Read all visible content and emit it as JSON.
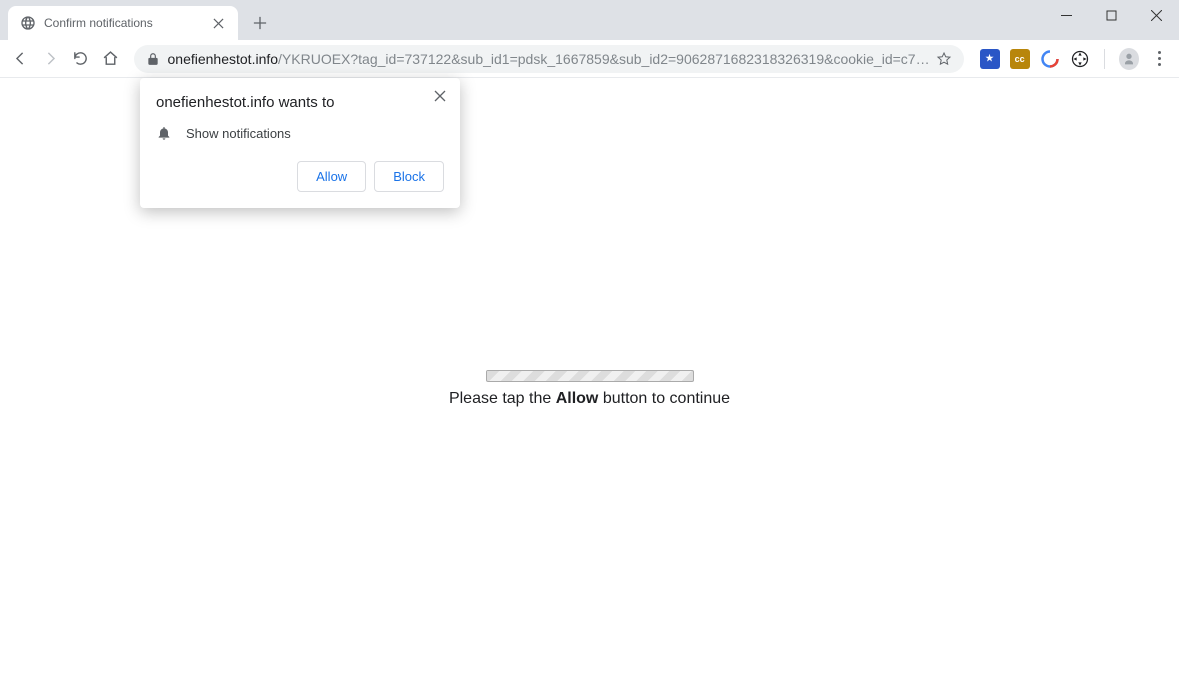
{
  "window": {
    "tab_title": "Confirm notifications"
  },
  "omnibox": {
    "domain": "onefienhestot.info",
    "path": "/YKRUOEX?tag_id=737122&sub_id1=pdsk_1667859&sub_id2=9062871682318326319&cookie_id=c7…"
  },
  "permission": {
    "title": "onefienhestot.info wants to",
    "request": "Show notifications",
    "allow_label": "Allow",
    "block_label": "Block"
  },
  "page": {
    "text_before": "Please tap the ",
    "text_bold": "Allow",
    "text_after": " button to continue"
  },
  "extensions": {
    "ext1_color": "#2a56c6",
    "ext2_color": "#b8860b",
    "ext2_label": "cc"
  }
}
